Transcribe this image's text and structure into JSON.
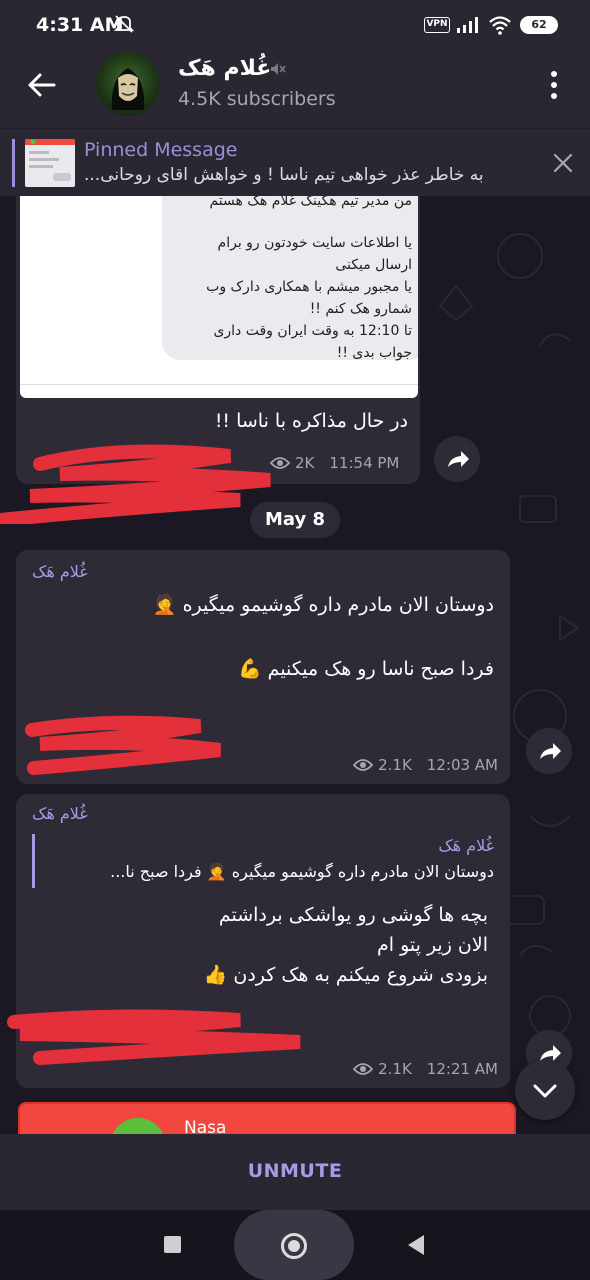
{
  "status_bar": {
    "time": "4:31 AM",
    "vpn": "VPN",
    "battery": "62",
    "icons": [
      "mute-icon",
      "signal-icon",
      "wifi-icon",
      "battery-icon"
    ]
  },
  "header": {
    "title": "غُلام هَک",
    "subscribers": "4.5K subscribers",
    "icons": [
      "back-arrow-icon",
      "muted-icon",
      "more-vert-icon"
    ]
  },
  "pinned": {
    "label": "Pinned Message",
    "text": "به خاطر عذر خواهی تیم ناسا ! و خواهش اقای روحانی..."
  },
  "messages": [
    {
      "image_lines": [
        "من مدیر تیم هکینگ غلام هک هستم",
        "",
        "یا اطلاعات سایت خودتون رو برام",
        "ارسال میکنی",
        "یا مجبور میشم با همکاری دارک وب",
        "شمارو هک کنم !!",
        "تا 12:10 به وقت ایران وقت داری",
        "جواب بدی !!"
      ],
      "text": "در حال مذاکره با ناسا !!",
      "views": "2K",
      "time": "11:54 PM"
    },
    {
      "author": "غُلام هَک",
      "lines": [
        "دوستان الان مادرم داره گوشیمو میگیره 🤦",
        "",
        "فردا صبح ناسا رو هک میکنیم 💪"
      ],
      "views": "2.1K",
      "time": "12:03 AM"
    },
    {
      "author": "غُلام هَک",
      "reply_author": "غُلام هَک",
      "reply_text": "دوستان الان مادرم داره گوشیمو میگیره 🤦  فردا صبح نا...",
      "lines": [
        "بچه ها گوشی رو یواشکی برداشتم",
        "الان زیر پتو ام",
        "بزودی شروع میکنم به هک کردن 👍"
      ],
      "views": "2.1K",
      "time": "12:21 AM"
    }
  ],
  "date_separator": "May 8",
  "next_message_preview": "Nasa",
  "bottom": {
    "unmute": "UNMUTE"
  },
  "colors": {
    "accent": "#a79be6",
    "bubble": "#2e2b37",
    "background": "#1b1823",
    "bar": "#2a2733"
  }
}
